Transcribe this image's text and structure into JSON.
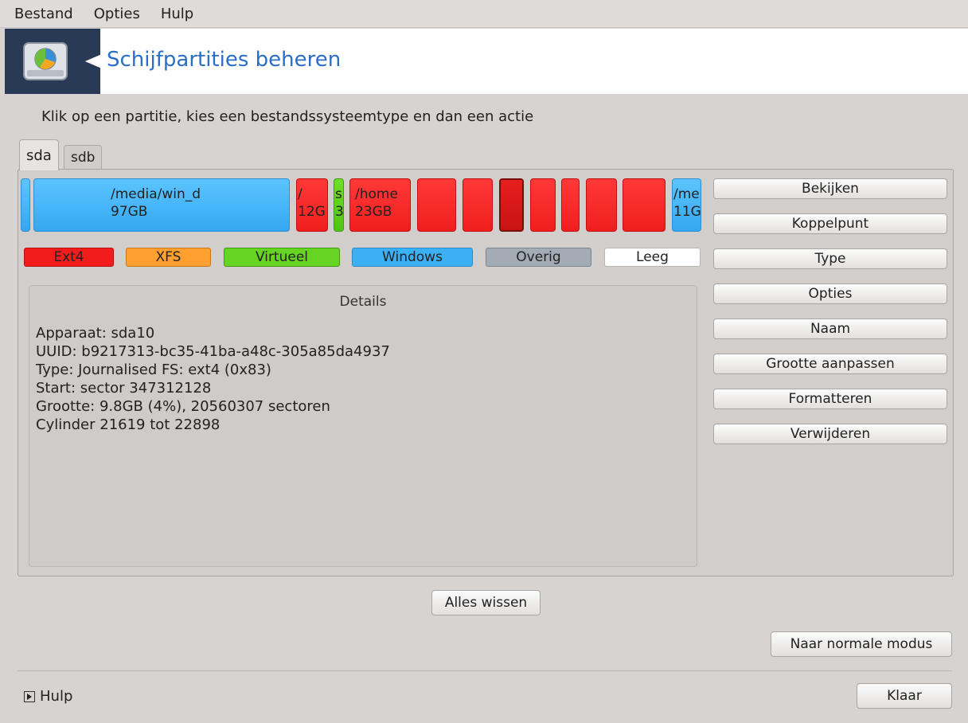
{
  "menubar": {
    "items": [
      "Bestand",
      "Opties",
      "Hulp"
    ]
  },
  "banner": {
    "title": "Schijfpartities beheren",
    "icon": "disk-partition-icon"
  },
  "instruction": "Klik op een partitie, kies een bestandssysteemtype en dan een actie",
  "tabs": [
    {
      "label": "sda",
      "active": true
    },
    {
      "label": "sdb",
      "active": false
    }
  ],
  "partitions": [
    {
      "type": "Windows",
      "line1": "",
      "line2": ""
    },
    {
      "type": "Windows",
      "line1": "/media/win_d",
      "line2": "97GB"
    },
    {
      "type": "Ext4",
      "line1": "/",
      "line2": "12G"
    },
    {
      "type": "Virtueel",
      "line1": "s",
      "line2": "3"
    },
    {
      "type": "Ext4",
      "line1": "/home",
      "line2": "23GB"
    },
    {
      "type": "Ext4",
      "line1": "",
      "line2": ""
    },
    {
      "type": "Ext4",
      "line1": "",
      "line2": ""
    },
    {
      "type": "Ext4",
      "line1": "",
      "line2": "",
      "selected": true
    },
    {
      "type": "Ext4",
      "line1": "",
      "line2": ""
    },
    {
      "type": "Ext4",
      "line1": "",
      "line2": ""
    },
    {
      "type": "Ext4",
      "line1": "",
      "line2": ""
    },
    {
      "type": "Ext4",
      "line1": "",
      "line2": ""
    },
    {
      "type": "Windows",
      "line1": "/me",
      "line2": "11G"
    }
  ],
  "legend": [
    {
      "label": "Ext4",
      "color": "#f21c1c"
    },
    {
      "label": "XFS",
      "color": "#ffa030"
    },
    {
      "label": "Virtueel",
      "color": "#66d422"
    },
    {
      "label": "Windows",
      "color": "#3cb0f5"
    },
    {
      "label": "Overig",
      "color": "#a3abb5"
    },
    {
      "label": "Leeg",
      "color": "#ffffff"
    }
  ],
  "details": {
    "title": "Details",
    "lines": [
      "Apparaat: sda10",
      "UUID: b9217313-bc35-41ba-a48c-305a85da4937",
      "Type: Journalised FS: ext4 (0x83)",
      "Start: sector 347312128",
      "Grootte: 9.8GB (4%), 20560307 sectoren",
      "Cylinder 21619 tot 22898"
    ]
  },
  "actions": [
    "Bekijken",
    "Koppelpunt",
    "Type",
    "Opties",
    "Naam",
    "Grootte aanpassen",
    "Formatteren",
    "Verwijderen"
  ],
  "clear_all": "Alles wissen",
  "normal_mode": "Naar normale modus",
  "help": "Hulp",
  "done": "Klaar"
}
